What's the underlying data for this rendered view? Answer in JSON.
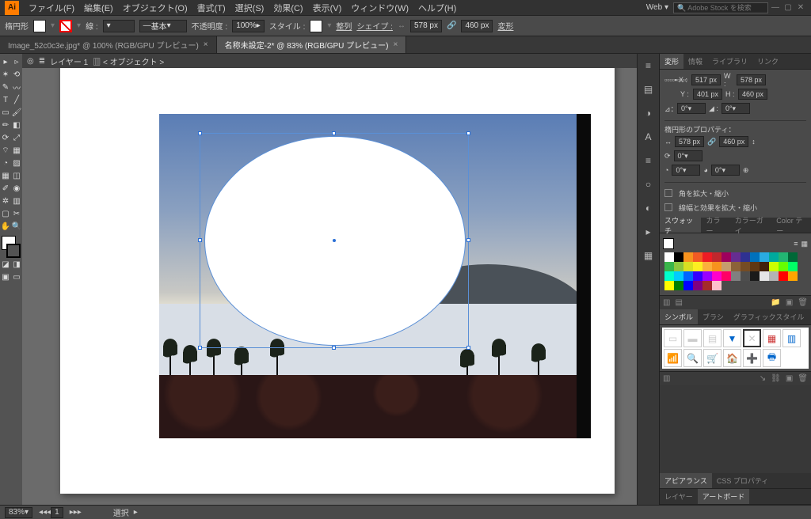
{
  "menu": {
    "items": [
      "ファイル(F)",
      "編集(E)",
      "オブジェクト(O)",
      "書式(T)",
      "選択(S)",
      "効果(C)",
      "表示(V)",
      "ウィンドウ(W)",
      "ヘルプ(H)"
    ],
    "workspace": "Web",
    "search_placeholder": "Adobe Stock を検索"
  },
  "ctrl": {
    "shape": "楕円形",
    "stroke_label": "線 :",
    "stroke_val": "",
    "stroke_style": "基本",
    "opacity_label": "不透明度 :",
    "opacity": "100%",
    "style_label": "スタイル :",
    "align": "整列",
    "shape_label": "シェイプ :",
    "w": "578 px",
    "h": "460 px",
    "transform": "変形"
  },
  "tabs": {
    "inactive": "Image_52c0c3e.jpg* @ 100% (RGB/GPU プレビュー)",
    "active": "名称未設定-2* @ 83% (RGB/GPU プレビュー)"
  },
  "layerbar": {
    "layer": "レイヤー 1",
    "target": "< オブジェクト >"
  },
  "status": {
    "zoom": "83%",
    "page": "1",
    "mode": "選択"
  },
  "transform": {
    "tabs": [
      "変形",
      "情報",
      "ライブラリ",
      "リンク"
    ],
    "x_lbl": "X :",
    "x": "517 px",
    "w_lbl": "W :",
    "w": "578 px",
    "y_lbl": "Y :",
    "y": "401 px",
    "h_lbl": "H :",
    "h": "460 px",
    "ang_lbl": "⊿：",
    "ang": "0°",
    "shear": "0°"
  },
  "props": {
    "title": "楕円形のプロパティ：",
    "w": "578 px",
    "h": "460 px",
    "rot": "0°",
    "pie1": "0°",
    "pie2": "0°"
  },
  "options": {
    "a": "角を拡大・縮小",
    "b": "線幅と効果を拡大・縮小"
  },
  "swatch_tabs": [
    "スウォッチ",
    "カラー",
    "カラーガイ",
    "Color テー"
  ],
  "swatch_colors": [
    "#ffffff",
    "#000000",
    "#f7931e",
    "#f15a24",
    "#ed1c24",
    "#c1272d",
    "#9e005d",
    "#662d91",
    "#2e3192",
    "#0071bc",
    "#29abe2",
    "#00a99d",
    "#22b573",
    "#006837",
    "#39b54a",
    "#8cc63f",
    "#d9e021",
    "#fcee21",
    "#fbb03b",
    "#f7931e",
    "#c69c6d",
    "#8c6239",
    "#754c24",
    "#603813",
    "#42210b",
    "#ccff00",
    "#66ff00",
    "#00ff66",
    "#00ffcc",
    "#00ccff",
    "#0066ff",
    "#3300ff",
    "#9900ff",
    "#ff00cc",
    "#ff0066",
    "#808080",
    "#4d4d4d",
    "#1a1a1a",
    "#e6e6e6",
    "#b3b3b3",
    "#ff0000",
    "#ffa500",
    "#ffff00",
    "#008000",
    "#0000ff",
    "#800080",
    "#a52a2a",
    "#ffc0cb"
  ],
  "symbol_tabs": [
    "シンボル",
    "ブラシ",
    "グラフィックスタイル"
  ],
  "appearance_tabs": [
    "アピアランス",
    "CSS プロパティ"
  ],
  "layer_tabs": [
    "レイヤー",
    "アートボード"
  ]
}
